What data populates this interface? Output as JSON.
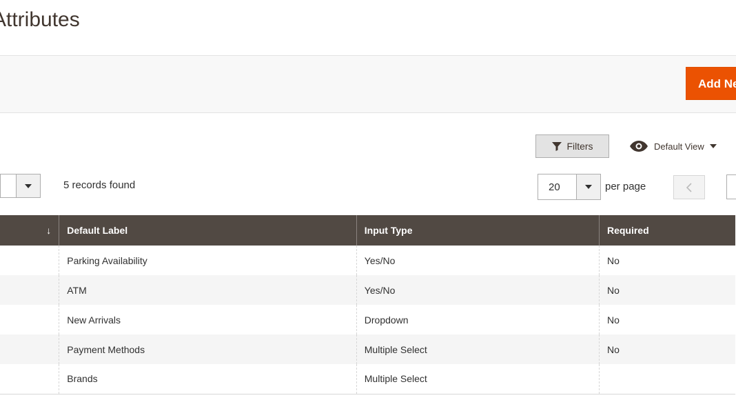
{
  "page": {
    "title": "Attributes"
  },
  "actions": {
    "add_label": "Add New Attribute",
    "add_visible_label": "Add Ne"
  },
  "toolbar": {
    "filters_label": "Filters",
    "view_label": "Default View",
    "records_found": "5 records found",
    "per_page_value": "20",
    "per_page_label": "per page"
  },
  "table": {
    "columns": [
      {
        "label": ""
      },
      {
        "label": "Default Label"
      },
      {
        "label": "Input Type"
      },
      {
        "label": "Required"
      }
    ],
    "sort_indicator": "↓",
    "rows": [
      {
        "label": "Parking Availability",
        "input_type": "Yes/No",
        "required": "No"
      },
      {
        "label": "ATM",
        "input_type": "Yes/No",
        "required": "No"
      },
      {
        "label": "New Arrivals",
        "input_type": "Dropdown",
        "required": "No"
      },
      {
        "label": "Payment Methods",
        "input_type": "Multiple Select",
        "required": "No"
      },
      {
        "label": "Brands",
        "input_type": "Multiple Select",
        "required": ""
      }
    ]
  },
  "colors": {
    "accent": "#eb5202",
    "header_bg": "#514943"
  },
  "icons": [
    "filter-icon",
    "eye-icon",
    "caret-down-icon",
    "chevron-left-icon",
    "sort-arrow-icon"
  ]
}
